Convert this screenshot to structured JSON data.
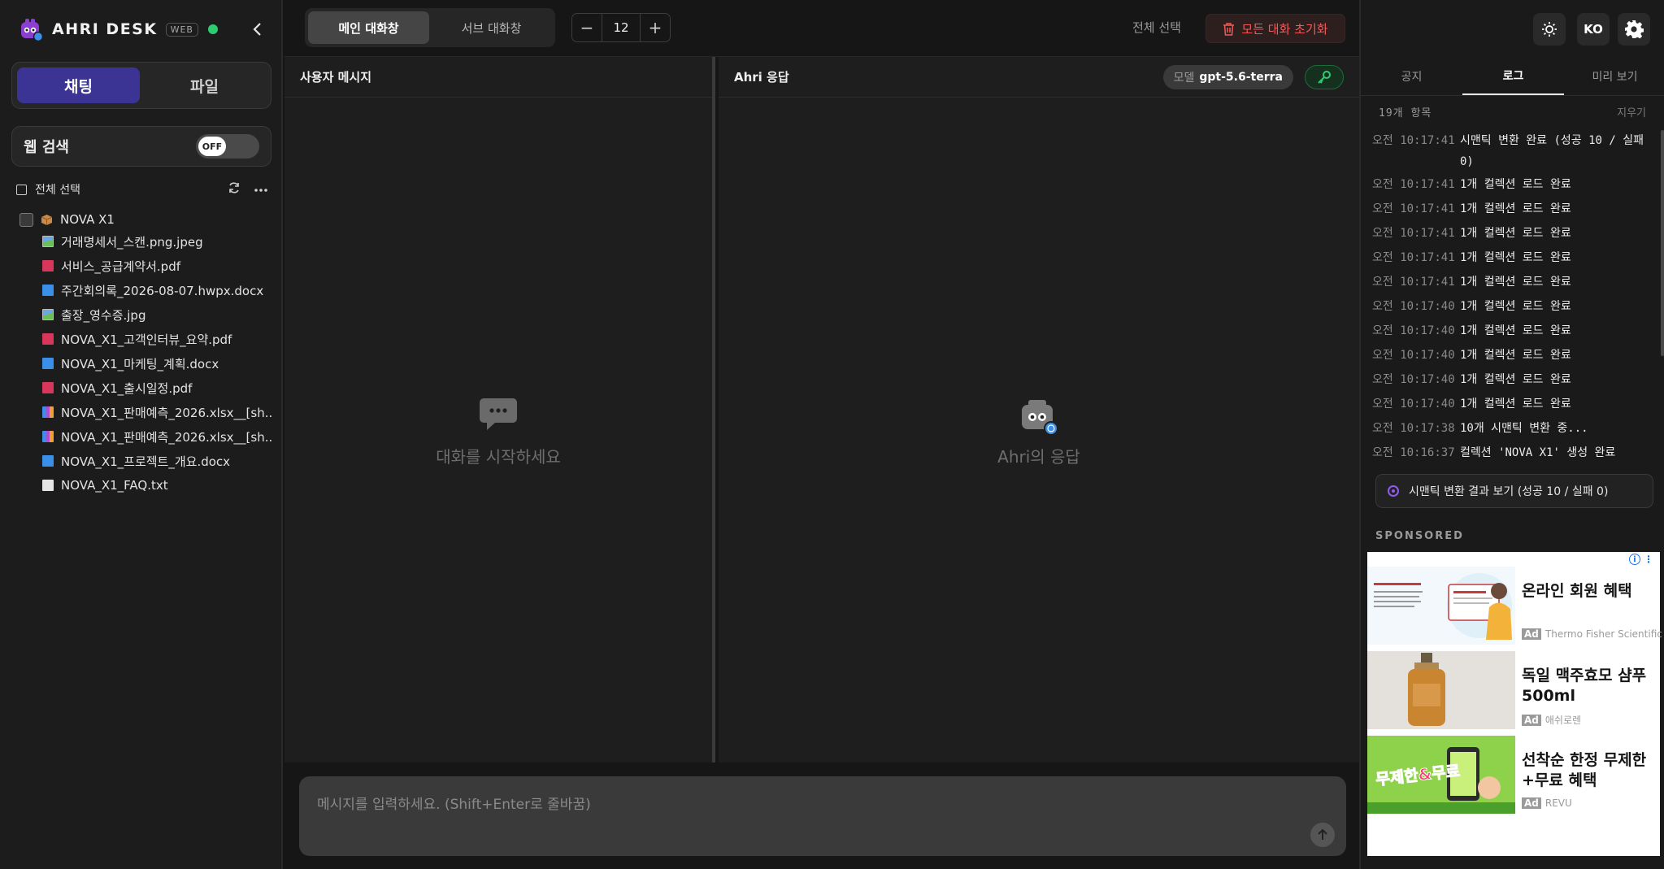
{
  "app": {
    "name": "AHRI DESK",
    "badge": "WEB",
    "status_color": "#2ecc71",
    "accent_color": "#3b3494"
  },
  "sidebar": {
    "mode_tabs": [
      {
        "label": "채팅",
        "active": true
      },
      {
        "label": "파일",
        "active": false
      }
    ],
    "web_search": {
      "label": "웹 검색",
      "toggle_text": "OFF"
    },
    "select_all": "전체 선택",
    "folder": {
      "name": "NOVA X1",
      "icon": "package-icon"
    },
    "files": [
      {
        "name": "거래명세서_스캔.png.jpeg",
        "type": "img"
      },
      {
        "name": "서비스_공급계약서.pdf",
        "type": "pdf"
      },
      {
        "name": "주간회의록_2026-08-07.hwpx.docx",
        "type": "docx"
      },
      {
        "name": "출장_영수증.jpg",
        "type": "img"
      },
      {
        "name": "NOVA_X1_고객인터뷰_요약.pdf",
        "type": "pdf"
      },
      {
        "name": "NOVA_X1_마케팅_계획.docx",
        "type": "docx"
      },
      {
        "name": "NOVA_X1_출시일정.pdf",
        "type": "pdf"
      },
      {
        "name": "NOVA_X1_판매예측_2026.xlsx__[sh...",
        "type": "xlsx"
      },
      {
        "name": "NOVA_X1_판매예측_2026.xlsx__[sh...",
        "type": "xlsx"
      },
      {
        "name": "NOVA_X1_프로젝트_개요.docx",
        "type": "docx"
      },
      {
        "name": "NOVA_X1_FAQ.txt",
        "type": "txt"
      }
    ]
  },
  "topbar": {
    "tabs": [
      {
        "label": "메인 대화창",
        "active": true
      },
      {
        "label": "서브 대화창",
        "active": false
      }
    ],
    "stepper": {
      "minus": "−",
      "value": "12",
      "plus": "+"
    },
    "select_all": "전체 선택",
    "reset_label": "모든 대화 초기화",
    "reset_color": "#f05a5a"
  },
  "user_pane": {
    "title": "사용자 메시지",
    "empty_text": "대화를 시작하세요"
  },
  "ahri_pane": {
    "title": "Ahri 응답",
    "model_label": "모델",
    "model_value": "gpt-5.6-terra",
    "empty_text": "Ahri의 응답"
  },
  "input": {
    "placeholder": "메시지를 입력하세요. (Shift+Enter로 줄바꿈)"
  },
  "right_panel": {
    "lang": "KO",
    "tabs": [
      {
        "label": "공지",
        "active": false
      },
      {
        "label": "로그",
        "active": true
      },
      {
        "label": "미리 보기",
        "active": false
      }
    ],
    "log_count": "19개 항목",
    "clear_label": "지우기",
    "logs": [
      {
        "time": "오전 10:17:41",
        "msg": "시맨틱 변환 완료 (성공 10 / 실패 0)"
      },
      {
        "time": "오전 10:17:41",
        "msg": "1개 컬렉션 로드 완료"
      },
      {
        "time": "오전 10:17:41",
        "msg": "1개 컬렉션 로드 완료"
      },
      {
        "time": "오전 10:17:41",
        "msg": "1개 컬렉션 로드 완료"
      },
      {
        "time": "오전 10:17:41",
        "msg": "1개 컬렉션 로드 완료"
      },
      {
        "time": "오전 10:17:41",
        "msg": "1개 컬렉션 로드 완료"
      },
      {
        "time": "오전 10:17:40",
        "msg": "1개 컬렉션 로드 완료"
      },
      {
        "time": "오전 10:17:40",
        "msg": "1개 컬렉션 로드 완료"
      },
      {
        "time": "오전 10:17:40",
        "msg": "1개 컬렉션 로드 완료"
      },
      {
        "time": "오전 10:17:40",
        "msg": "1개 컬렉션 로드 완료"
      },
      {
        "time": "오전 10:17:40",
        "msg": "1개 컬렉션 로드 완료"
      },
      {
        "time": "오전 10:17:38",
        "msg": "10개 시맨틱 변환 중..."
      },
      {
        "time": "오전 10:16:37",
        "msg": "컬렉션 'NOVA X1' 생성 완료"
      }
    ],
    "semantic_button": "시맨틱 변환 결과 보기 (성공 10 / 실패 0)",
    "sponsored": "SPONSORED",
    "ads": [
      {
        "title": "온라인 회원 혜택",
        "tag": "Ad",
        "source": "Thermo Fisher Scientific"
      },
      {
        "title": "독일 맥주효모 샴푸 500ml",
        "tag": "Ad",
        "source": "애쉬로렌"
      },
      {
        "title": "선착순 한정 무제한+무료 혜택",
        "tag": "Ad",
        "source": "REVU"
      }
    ],
    "ad_banner_text": "무제한&무료"
  }
}
